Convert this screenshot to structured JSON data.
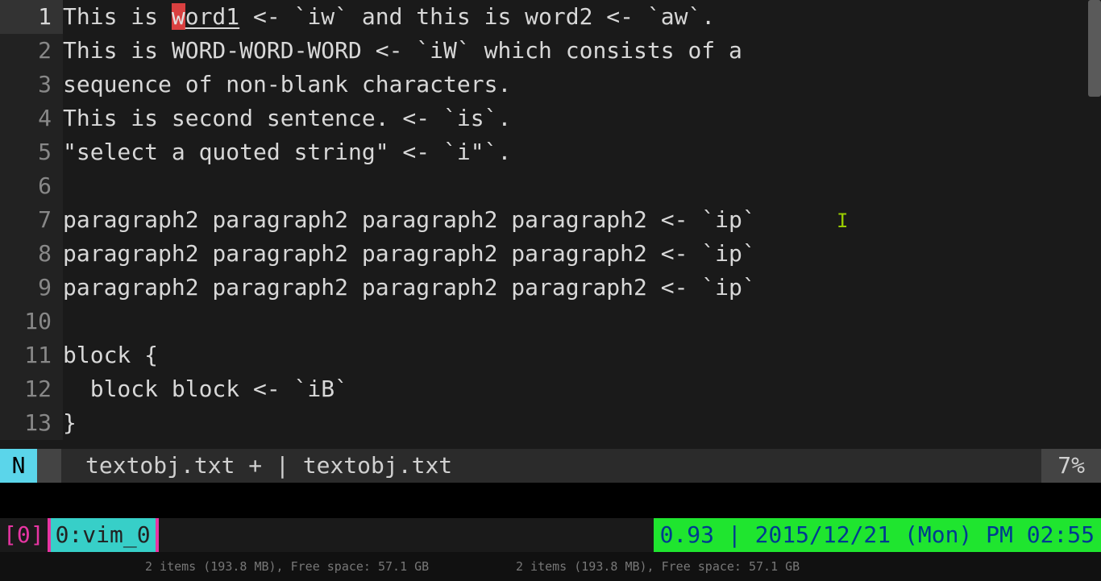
{
  "editor": {
    "lines": [
      {
        "n": "1",
        "pre": "This is ",
        "cursor": "w",
        "underlined": "ord1",
        "post": " <- `iw` and this is word2 <- `aw`."
      },
      {
        "n": "2",
        "text": "This is WORD-WORD-WORD <- `iW` which consists of a"
      },
      {
        "n": "3",
        "text": "sequence of non-blank characters."
      },
      {
        "n": "4",
        "text": "This is second sentence. <- `is`."
      },
      {
        "n": "5",
        "text": "\"select a quoted string\" <- `i\"`."
      },
      {
        "n": "6",
        "text": ""
      },
      {
        "n": "7",
        "text": "paragraph2 paragraph2 paragraph2 paragraph2 <- `ip`"
      },
      {
        "n": "8",
        "text": "paragraph2 paragraph2 paragraph2 paragraph2 <- `ip`"
      },
      {
        "n": "9",
        "text": "paragraph2 paragraph2 paragraph2 paragraph2 <- `ip`"
      },
      {
        "n": "10",
        "text": ""
      },
      {
        "n": "11",
        "text": "block {"
      },
      {
        "n": "12",
        "text": "  block block <- `iB`"
      },
      {
        "n": "13",
        "text": "}"
      }
    ]
  },
  "statusline": {
    "mode": "N",
    "file_a": "textobj.txt + ",
    "file_b": "| textobj.txt",
    "percent": "7%"
  },
  "tmux": {
    "session": "[0]",
    "window": "0:vim_0",
    "right": "0.93 | 2015/12/21 (Mon) PM 02:55"
  },
  "bottom": {
    "text_a": "2 items (193.8 MB), Free space: 57.1 GB",
    "text_b": "2 items (193.8 MB), Free space: 57.1 GB"
  }
}
